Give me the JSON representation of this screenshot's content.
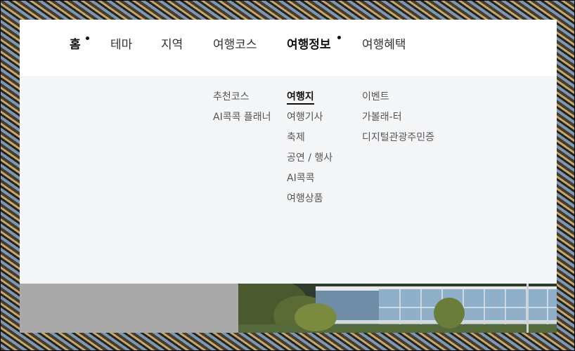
{
  "nav": {
    "items": [
      {
        "label": "홈"
      },
      {
        "label": "테마"
      },
      {
        "label": "지역"
      },
      {
        "label": "여행코스"
      },
      {
        "label": "여행정보"
      },
      {
        "label": "여행혜택"
      }
    ]
  },
  "submenu": {
    "col1": [
      "추천코스",
      "AI콕콕 플래너"
    ],
    "col2": [
      "여행지",
      "여행기사",
      "축제",
      "공연 / 행사",
      "AI콕콕",
      "여행상품"
    ],
    "col3": [
      "이벤트",
      "가볼래-터",
      "디지털관광주민증"
    ]
  }
}
